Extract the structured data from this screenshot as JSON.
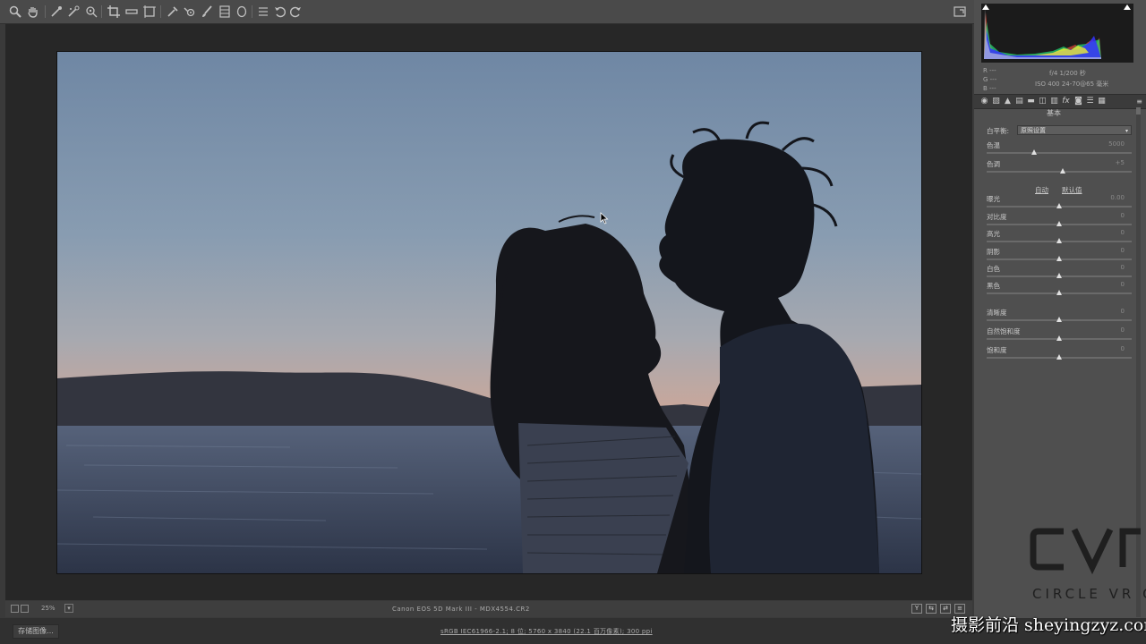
{
  "toolbar": {
    "tools": [
      "zoom-tool-icon",
      "hand-tool-icon",
      "white-balance-tool-icon",
      "color-sampler-icon",
      "target-adjustment-icon",
      "crop-tool-icon",
      "straighten-tool-icon",
      "transform-tool-icon",
      "spot-removal-icon",
      "red-eye-icon",
      "adjustment-brush-icon",
      "graduated-filter-icon",
      "radial-filter-icon",
      "preferences-icon",
      "rotate-ccw-icon",
      "rotate-cw-icon"
    ]
  },
  "histogram_panel": {
    "rgb": {
      "r": "R  ---",
      "g": "G  ---",
      "b": "B  ---"
    },
    "exif_line1": "f/4  1/200 秒",
    "exif_line2": "ISO 400  24-70@65 毫米"
  },
  "panel": {
    "section_title": "基本",
    "white_balance": {
      "label": "白平衡:",
      "value": "原照设置"
    },
    "sliders": [
      {
        "key": "temperature",
        "label": "色温",
        "value": "5000",
        "pos": 0.33
      },
      {
        "key": "tint",
        "label": "色调",
        "value": "+5",
        "pos": 0.53
      },
      {
        "key": "exposure",
        "label": "曝光",
        "value": "0.00",
        "pos": 0.5
      },
      {
        "key": "contrast",
        "label": "对比度",
        "value": "0",
        "pos": 0.5
      },
      {
        "key": "highlights",
        "label": "高光",
        "value": "0",
        "pos": 0.5
      },
      {
        "key": "shadows",
        "label": "阴影",
        "value": "0",
        "pos": 0.5
      },
      {
        "key": "whites",
        "label": "白色",
        "value": "0",
        "pos": 0.5
      },
      {
        "key": "blacks",
        "label": "黑色",
        "value": "0",
        "pos": 0.5
      },
      {
        "key": "clarity",
        "label": "清晰度",
        "value": "0",
        "pos": 0.5
      },
      {
        "key": "vibrance",
        "label": "自然饱和度",
        "value": "0",
        "pos": 0.5
      },
      {
        "key": "saturation",
        "label": "饱和度",
        "value": "0",
        "pos": 0.5
      }
    ],
    "auto_label": "自动",
    "default_label": "默认值"
  },
  "status": {
    "zoom": "25%",
    "camera_file": "Canon EOS 5D Mark III  -  MDX4554.CR2"
  },
  "bottom": {
    "save_label": "存储图像...",
    "workflow": "sRGB IEC61966-2.1; 8 位; 5760 x 3840 (22.1 百万像素); 300 ppi"
  },
  "watermarks": {
    "cvr_logo": "CVR",
    "cvr_text": "CIRCLE VR C",
    "site": "摄影前沿 sheyingzyz.com"
  },
  "colors": {
    "panel_bg": "#4f4f4f",
    "preview_bg": "#272727",
    "toolbar_bg": "#4a4a4a"
  }
}
